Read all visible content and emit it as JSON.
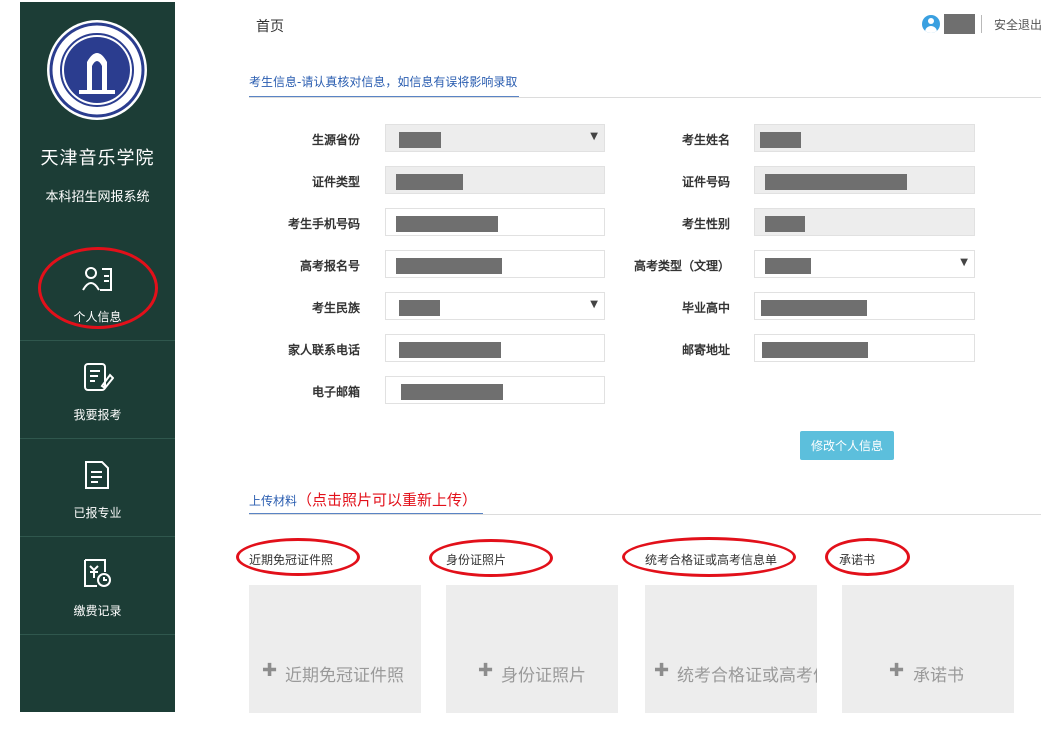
{
  "sidebar": {
    "school_name": "天津音乐学院",
    "system_name": "本科招生网报系统",
    "items": [
      {
        "label": "个人信息",
        "icon": "id-card-icon"
      },
      {
        "label": "我要报考",
        "icon": "edit-form-icon"
      },
      {
        "label": "已报专业",
        "icon": "checklist-icon"
      },
      {
        "label": "缴费记录",
        "icon": "payment-icon"
      }
    ]
  },
  "header": {
    "breadcrumb": "首页",
    "logout": "安全退出"
  },
  "info": {
    "tab": "考生信息-请认真核对信息，如信息有误将影响录取",
    "left_labels": [
      "生源省份",
      "证件类型",
      "考生手机号码",
      "高考报名号",
      "考生民族",
      "家人联系电话",
      "电子邮箱"
    ],
    "right_labels": [
      "考生姓名",
      "证件号码",
      "考生性别",
      "高考类型（文理）",
      "毕业高中",
      "邮寄地址"
    ],
    "modify_button": "修改个人信息"
  },
  "upload": {
    "tab": "上传材料",
    "note": "（点击照片可以重新上传）",
    "items": [
      {
        "title": "近期免冠证件照",
        "box": "近期免冠证件照"
      },
      {
        "title": "身份证照片",
        "box": "身份证照片"
      },
      {
        "title": "统考合格证或高考信息单",
        "box": "统考合格证或高考信息单"
      },
      {
        "title": "承诺书",
        "box": "承诺书"
      }
    ]
  },
  "colors": {
    "sidebar_bg": "#1c3d36",
    "accent_blue": "#2a5db0",
    "button": "#5cbfdc",
    "annotation_red": "#e2101a"
  }
}
